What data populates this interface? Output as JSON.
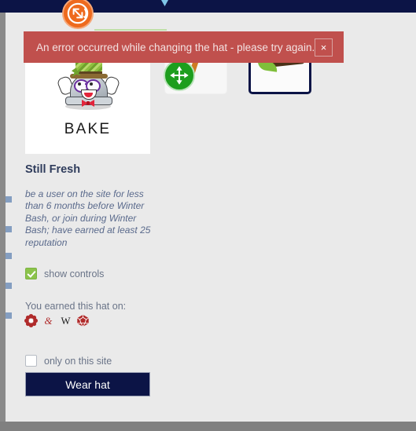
{
  "window": {
    "background_color": "#808080",
    "page_background": "#eaeaea",
    "topbar_color": "#0c1446"
  },
  "error_banner": {
    "message": "An error occurred while changing the hat - please try again.",
    "close_label": "×",
    "background_color": "#c0504d",
    "text_color": "#f3e2e2"
  },
  "preview": {
    "hat_name_on_image": "BAKE",
    "rotate_handle_icon": "rotate-resize-icon",
    "move_handle_icon": "move-arrows-icon",
    "rotate_handle_color": "#ee6a1e",
    "move_handle_color": "#1d9e1d"
  },
  "thumbnails": [
    {
      "name": "boomerang-hat-thumbnail",
      "selected": false
    },
    {
      "name": "grass-log-hat-thumbnail",
      "selected": true
    }
  ],
  "details": {
    "title": "Still Fresh",
    "description": "be a user on the site for less than 6 months before Winter Bash, or join during Winter Bash; have earned at least 25 reputation",
    "title_color": "#2f3c5c",
    "description_color": "#5a6a8c"
  },
  "options": {
    "show_controls": {
      "label": "show controls",
      "checked": true
    },
    "only_on_this_site": {
      "label": "only on this site",
      "checked": false
    }
  },
  "earned": {
    "label": "You earned this hat on:",
    "sites": [
      {
        "name": "worldbuilding-site-icon",
        "glyph": "✿",
        "color": "#b02b2b"
      },
      {
        "name": "writing-site-icon",
        "glyph": "&",
        "color": "#b02b2b"
      },
      {
        "name": "wikipedia-site-icon",
        "glyph": "W",
        "color": "#1a1a1a"
      },
      {
        "name": "rpg-site-icon",
        "glyph": "⬡",
        "color": "#b02b2b"
      }
    ]
  },
  "actions": {
    "wear_hat": "Wear hat",
    "wear_hat_color": "#0c1446"
  }
}
